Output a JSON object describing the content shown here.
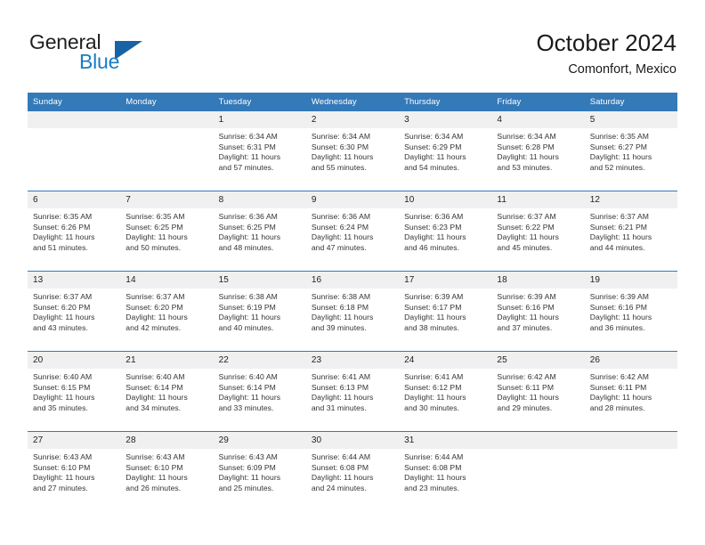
{
  "brand": {
    "name_part1": "General",
    "name_part2": "Blue",
    "logo_icon": "blue-triangle-icon"
  },
  "header": {
    "title": "October 2024",
    "subtitle": "Comonfort, Mexico"
  },
  "colors": {
    "header_band": "#3479b8",
    "daynum_band": "#f0f0f0",
    "brand_blue": "#1a7dc4",
    "logo_blue": "#1763a5",
    "text": "#333333"
  },
  "weekday_headers": [
    "Sunday",
    "Monday",
    "Tuesday",
    "Wednesday",
    "Thursday",
    "Friday",
    "Saturday"
  ],
  "labels": {
    "sunrise_prefix": "Sunrise:",
    "sunset_prefix": "Sunset:",
    "daylight_prefix": "Daylight:"
  },
  "weeks": [
    [
      {
        "day": "",
        "blank": true,
        "sunrise": "",
        "sunset": "",
        "daylight_1": "",
        "daylight_2": ""
      },
      {
        "day": "",
        "blank": true,
        "sunrise": "",
        "sunset": "",
        "daylight_1": "",
        "daylight_2": ""
      },
      {
        "day": "1",
        "sunrise": "Sunrise: 6:34 AM",
        "sunset": "Sunset: 6:31 PM",
        "daylight_1": "Daylight: 11 hours",
        "daylight_2": "and 57 minutes."
      },
      {
        "day": "2",
        "sunrise": "Sunrise: 6:34 AM",
        "sunset": "Sunset: 6:30 PM",
        "daylight_1": "Daylight: 11 hours",
        "daylight_2": "and 55 minutes."
      },
      {
        "day": "3",
        "sunrise": "Sunrise: 6:34 AM",
        "sunset": "Sunset: 6:29 PM",
        "daylight_1": "Daylight: 11 hours",
        "daylight_2": "and 54 minutes."
      },
      {
        "day": "4",
        "sunrise": "Sunrise: 6:34 AM",
        "sunset": "Sunset: 6:28 PM",
        "daylight_1": "Daylight: 11 hours",
        "daylight_2": "and 53 minutes."
      },
      {
        "day": "5",
        "sunrise": "Sunrise: 6:35 AM",
        "sunset": "Sunset: 6:27 PM",
        "daylight_1": "Daylight: 11 hours",
        "daylight_2": "and 52 minutes."
      }
    ],
    [
      {
        "day": "6",
        "sunrise": "Sunrise: 6:35 AM",
        "sunset": "Sunset: 6:26 PM",
        "daylight_1": "Daylight: 11 hours",
        "daylight_2": "and 51 minutes."
      },
      {
        "day": "7",
        "sunrise": "Sunrise: 6:35 AM",
        "sunset": "Sunset: 6:25 PM",
        "daylight_1": "Daylight: 11 hours",
        "daylight_2": "and 50 minutes."
      },
      {
        "day": "8",
        "sunrise": "Sunrise: 6:36 AM",
        "sunset": "Sunset: 6:25 PM",
        "daylight_1": "Daylight: 11 hours",
        "daylight_2": "and 48 minutes."
      },
      {
        "day": "9",
        "sunrise": "Sunrise: 6:36 AM",
        "sunset": "Sunset: 6:24 PM",
        "daylight_1": "Daylight: 11 hours",
        "daylight_2": "and 47 minutes."
      },
      {
        "day": "10",
        "sunrise": "Sunrise: 6:36 AM",
        "sunset": "Sunset: 6:23 PM",
        "daylight_1": "Daylight: 11 hours",
        "daylight_2": "and 46 minutes."
      },
      {
        "day": "11",
        "sunrise": "Sunrise: 6:37 AM",
        "sunset": "Sunset: 6:22 PM",
        "daylight_1": "Daylight: 11 hours",
        "daylight_2": "and 45 minutes."
      },
      {
        "day": "12",
        "sunrise": "Sunrise: 6:37 AM",
        "sunset": "Sunset: 6:21 PM",
        "daylight_1": "Daylight: 11 hours",
        "daylight_2": "and 44 minutes."
      }
    ],
    [
      {
        "day": "13",
        "sunrise": "Sunrise: 6:37 AM",
        "sunset": "Sunset: 6:20 PM",
        "daylight_1": "Daylight: 11 hours",
        "daylight_2": "and 43 minutes."
      },
      {
        "day": "14",
        "sunrise": "Sunrise: 6:37 AM",
        "sunset": "Sunset: 6:20 PM",
        "daylight_1": "Daylight: 11 hours",
        "daylight_2": "and 42 minutes."
      },
      {
        "day": "15",
        "sunrise": "Sunrise: 6:38 AM",
        "sunset": "Sunset: 6:19 PM",
        "daylight_1": "Daylight: 11 hours",
        "daylight_2": "and 40 minutes."
      },
      {
        "day": "16",
        "sunrise": "Sunrise: 6:38 AM",
        "sunset": "Sunset: 6:18 PM",
        "daylight_1": "Daylight: 11 hours",
        "daylight_2": "and 39 minutes."
      },
      {
        "day": "17",
        "sunrise": "Sunrise: 6:39 AM",
        "sunset": "Sunset: 6:17 PM",
        "daylight_1": "Daylight: 11 hours",
        "daylight_2": "and 38 minutes."
      },
      {
        "day": "18",
        "sunrise": "Sunrise: 6:39 AM",
        "sunset": "Sunset: 6:16 PM",
        "daylight_1": "Daylight: 11 hours",
        "daylight_2": "and 37 minutes."
      },
      {
        "day": "19",
        "sunrise": "Sunrise: 6:39 AM",
        "sunset": "Sunset: 6:16 PM",
        "daylight_1": "Daylight: 11 hours",
        "daylight_2": "and 36 minutes."
      }
    ],
    [
      {
        "day": "20",
        "sunrise": "Sunrise: 6:40 AM",
        "sunset": "Sunset: 6:15 PM",
        "daylight_1": "Daylight: 11 hours",
        "daylight_2": "and 35 minutes."
      },
      {
        "day": "21",
        "sunrise": "Sunrise: 6:40 AM",
        "sunset": "Sunset: 6:14 PM",
        "daylight_1": "Daylight: 11 hours",
        "daylight_2": "and 34 minutes."
      },
      {
        "day": "22",
        "sunrise": "Sunrise: 6:40 AM",
        "sunset": "Sunset: 6:14 PM",
        "daylight_1": "Daylight: 11 hours",
        "daylight_2": "and 33 minutes."
      },
      {
        "day": "23",
        "sunrise": "Sunrise: 6:41 AM",
        "sunset": "Sunset: 6:13 PM",
        "daylight_1": "Daylight: 11 hours",
        "daylight_2": "and 31 minutes."
      },
      {
        "day": "24",
        "sunrise": "Sunrise: 6:41 AM",
        "sunset": "Sunset: 6:12 PM",
        "daylight_1": "Daylight: 11 hours",
        "daylight_2": "and 30 minutes."
      },
      {
        "day": "25",
        "sunrise": "Sunrise: 6:42 AM",
        "sunset": "Sunset: 6:11 PM",
        "daylight_1": "Daylight: 11 hours",
        "daylight_2": "and 29 minutes."
      },
      {
        "day": "26",
        "sunrise": "Sunrise: 6:42 AM",
        "sunset": "Sunset: 6:11 PM",
        "daylight_1": "Daylight: 11 hours",
        "daylight_2": "and 28 minutes."
      }
    ],
    [
      {
        "day": "27",
        "sunrise": "Sunrise: 6:43 AM",
        "sunset": "Sunset: 6:10 PM",
        "daylight_1": "Daylight: 11 hours",
        "daylight_2": "and 27 minutes."
      },
      {
        "day": "28",
        "sunrise": "Sunrise: 6:43 AM",
        "sunset": "Sunset: 6:10 PM",
        "daylight_1": "Daylight: 11 hours",
        "daylight_2": "and 26 minutes."
      },
      {
        "day": "29",
        "sunrise": "Sunrise: 6:43 AM",
        "sunset": "Sunset: 6:09 PM",
        "daylight_1": "Daylight: 11 hours",
        "daylight_2": "and 25 minutes."
      },
      {
        "day": "30",
        "sunrise": "Sunrise: 6:44 AM",
        "sunset": "Sunset: 6:08 PM",
        "daylight_1": "Daylight: 11 hours",
        "daylight_2": "and 24 minutes."
      },
      {
        "day": "31",
        "sunrise": "Sunrise: 6:44 AM",
        "sunset": "Sunset: 6:08 PM",
        "daylight_1": "Daylight: 11 hours",
        "daylight_2": "and 23 minutes."
      },
      {
        "day": "",
        "blank": true,
        "sunrise": "",
        "sunset": "",
        "daylight_1": "",
        "daylight_2": ""
      },
      {
        "day": "",
        "blank": true,
        "sunrise": "",
        "sunset": "",
        "daylight_1": "",
        "daylight_2": ""
      }
    ]
  ]
}
